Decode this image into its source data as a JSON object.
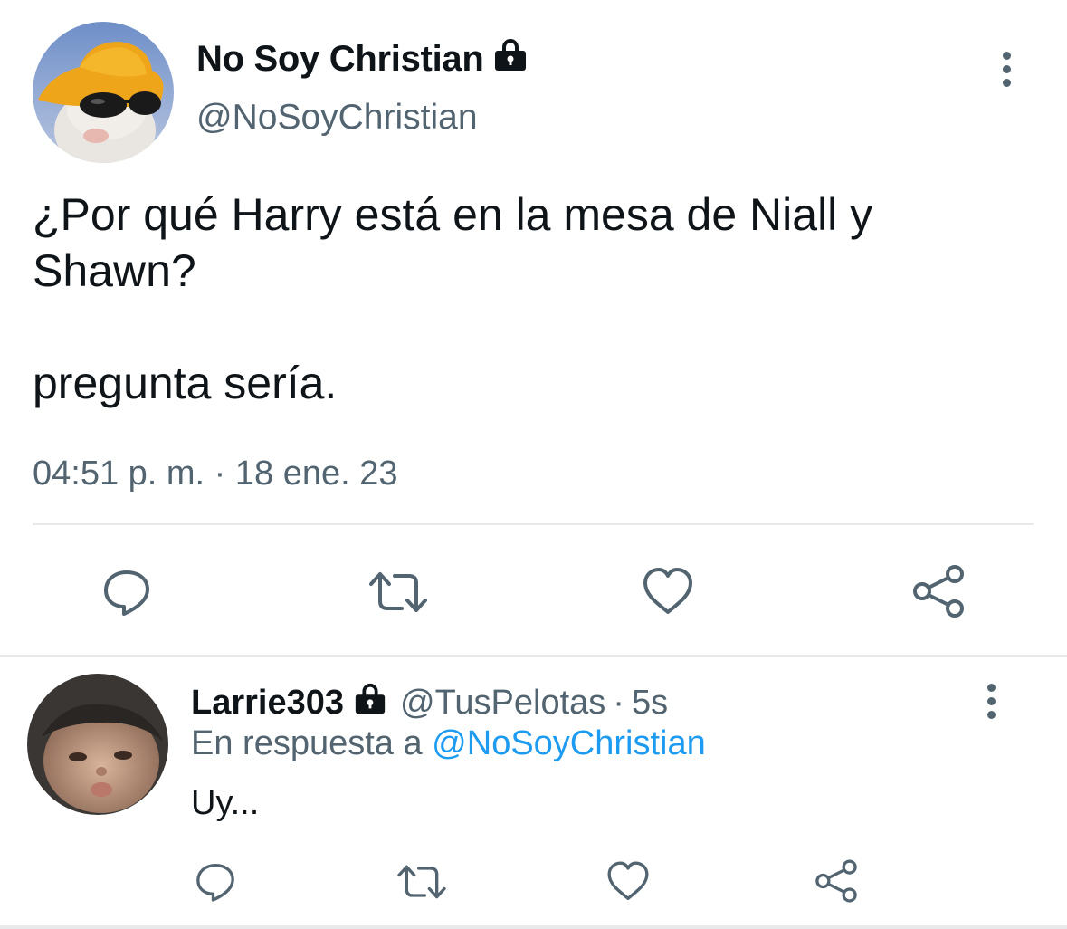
{
  "main_tweet": {
    "display_name": "No Soy Christian",
    "handle": "@NoSoyChristian",
    "text_line_1": "¿Por qué Harry está en la mesa de Niall y Shawn?",
    "text_line_2": "pregunta sería.",
    "timestamp": "04:51 p. m. · 18 ene. 23",
    "protected": true,
    "actions": [
      "reply-icon",
      "retweet-icon",
      "like-icon",
      "share-icon"
    ]
  },
  "reply": {
    "display_name": "Larrie303",
    "handle": "@TusPelotas",
    "separator": "·",
    "time": "5s",
    "replying_prefix": "En respuesta a",
    "replying_to": "@NoSoyChristian",
    "text": "Uy...",
    "protected": true,
    "actions": [
      "reply-icon",
      "retweet-icon",
      "like-icon",
      "share-icon"
    ]
  },
  "colors": {
    "text_primary": "#0f1419",
    "text_secondary": "#536471",
    "link": "#1d9bf0",
    "divider": "#e7e9ea"
  }
}
